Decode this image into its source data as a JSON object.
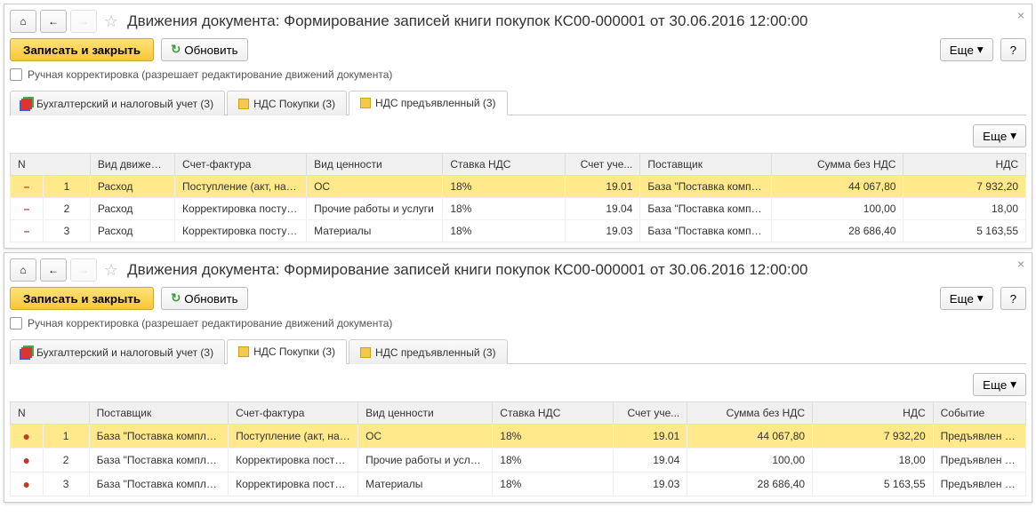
{
  "common": {
    "title": "Движения документа: Формирование записей книги покупок КС00-000001 от 30.06.2016 12:00:00",
    "save_close": "Записать и закрыть",
    "refresh": "Обновить",
    "more": "Еще",
    "help": "?",
    "manual_edit": "Ручная корректировка (разрешает редактирование движений документа)",
    "tabs": {
      "t1": "Бухгалтерский и налоговый учет (3)",
      "t2": "НДС Покупки (3)",
      "t3": "НДС предъявленный (3)"
    }
  },
  "top": {
    "headers": {
      "n": "N",
      "movement": "Вид движения",
      "invoice": "Счет-фактура",
      "valtype": "Вид ценности",
      "vat": "Ставка НДС",
      "account": "Счет уче...",
      "supplier": "Поставщик",
      "sum": "Сумма без НДС",
      "nds": "НДС"
    },
    "rows": [
      {
        "n": "1",
        "movement": "Расход",
        "invoice": "Поступление (акт, накл...",
        "valtype": "ОС",
        "vat": "18%",
        "account": "19.01",
        "supplier": "База \"Поставка компле...",
        "sum": "44 067,80",
        "nds": "7 932,20"
      },
      {
        "n": "2",
        "movement": "Расход",
        "invoice": "Корректировка поступл...",
        "valtype": "Прочие работы и услуги",
        "vat": "18%",
        "account": "19.04",
        "supplier": "База \"Поставка компле...",
        "sum": "100,00",
        "nds": "18,00"
      },
      {
        "n": "3",
        "movement": "Расход",
        "invoice": "Корректировка поступл...",
        "valtype": "Материалы",
        "vat": "18%",
        "account": "19.03",
        "supplier": "База \"Поставка компле...",
        "sum": "28 686,40",
        "nds": "5 163,55"
      }
    ]
  },
  "bottom": {
    "headers": {
      "n": "N",
      "supplier": "Поставщик",
      "invoice": "Счет-фактура",
      "valtype": "Вид ценности",
      "vat": "Ставка НДС",
      "account": "Счет уче...",
      "sum": "Сумма без НДС",
      "nds": "НДС",
      "event": "Событие"
    },
    "rows": [
      {
        "n": "1",
        "supplier": "База \"Поставка компле...",
        "invoice": "Поступление (акт, накл...",
        "valtype": "ОС",
        "vat": "18%",
        "account": "19.01",
        "sum": "44 067,80",
        "nds": "7 932,20",
        "event": "Предъявлен НДС"
      },
      {
        "n": "2",
        "supplier": "База \"Поставка компле...",
        "invoice": "Корректировка поступл...",
        "valtype": "Прочие работы и услуги",
        "vat": "18%",
        "account": "19.04",
        "sum": "100,00",
        "nds": "18,00",
        "event": "Предъявлен НДС"
      },
      {
        "n": "3",
        "supplier": "База \"Поставка компле...",
        "invoice": "Корректировка поступл...",
        "valtype": "Материалы",
        "vat": "18%",
        "account": "19.03",
        "sum": "28 686,40",
        "nds": "5 163,55",
        "event": "Предъявлен НДС"
      }
    ]
  }
}
